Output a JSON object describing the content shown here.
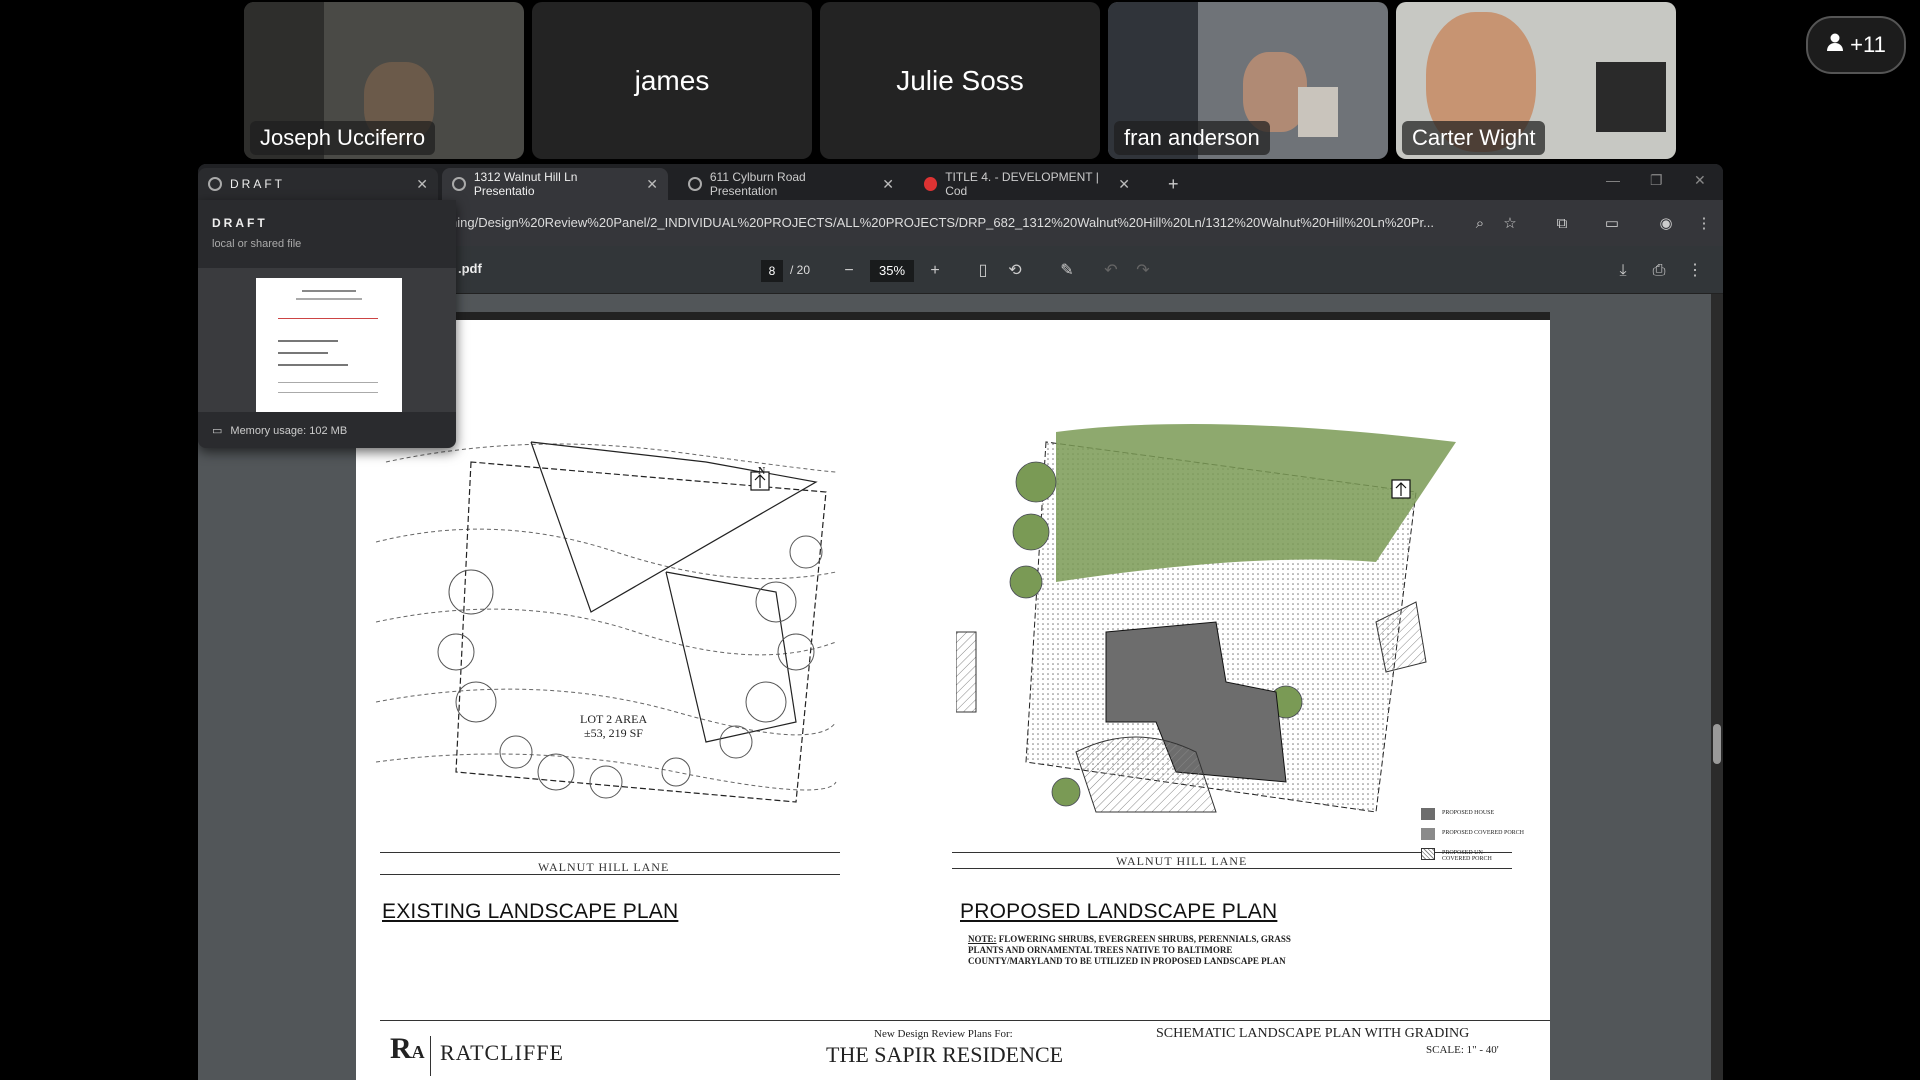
{
  "participants": [
    {
      "name": "Joseph Ucciferro",
      "video": true
    },
    {
      "name": "james",
      "video": false
    },
    {
      "name": "Julie Soss",
      "video": false
    },
    {
      "name": "fran anderson",
      "video": true
    },
    {
      "name": "Carter Wight",
      "video": true
    }
  ],
  "more_participants": "+11",
  "tabs": [
    {
      "title": "DRAFT"
    },
    {
      "title": "1312 Walnut Hill Ln Presentatio"
    },
    {
      "title": "611 Cylburn Road Presentation"
    },
    {
      "title": "TITLE 4. - DEVELOPMENT | Cod"
    }
  ],
  "hover_card": {
    "title": "DRAFT",
    "subtitle": "local or shared file",
    "memory": "Memory usage: 102 MB"
  },
  "url": "ning/Design%20Review%20Panel/2_INDIVIDUAL%20PROJECTS/ALL%20PROJECTS/DRP_682_1312%20Walnut%20Hill%20Ln/1312%20Walnut%20Hill%20Ln%20Pr...",
  "pdf": {
    "filename": ".pdf",
    "page": "8",
    "total": "/ 20",
    "zoom": "35%"
  },
  "drawing": {
    "existing_title": "EXISTING LANDSCAPE PLAN",
    "proposed_title": "PROPOSED LANDSCAPE PLAN",
    "lane_left": "WALNUT HILL LANE",
    "lane_right": "WALNUT HILL LANE",
    "lot_label": "LOT 2 AREA",
    "lot_area": "±53, 219 SF",
    "north": "N",
    "note_label": "NOTE:",
    "note_text": "FLOWERING SHRUBS, EVERGREEN SHRUBS, PERENNIALS, GRASS PLANTS AND ORNAMENTAL TREES NATIVE TO BALTIMORE COUNTY/MARYLAND TO BE UTILIZED IN PROPOSED LANDSCAPE PLAN",
    "legend": [
      "PROPOSED HOUSE",
      "PROPOSED COVERED PORCH",
      "PROPOSED UN-COVERED PORCH"
    ],
    "firm": "RATCLIFFE",
    "plans_for": "New Design Review Plans For:",
    "residence": "THE SAPIR RESIDENCE",
    "sheet_title": "SCHEMATIC LANDSCAPE PLAN WITH GRADING",
    "scale": "SCALE: 1\" - 40'"
  },
  "colors": {
    "tree_green": "#7a9a55",
    "house_gray": "#6d6d6d",
    "chrome_bg": "#35363a",
    "pdf_bg": "#525659"
  }
}
